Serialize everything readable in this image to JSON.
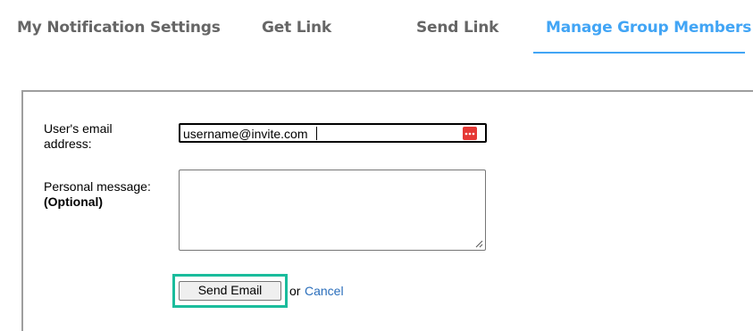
{
  "tabs": {
    "notification_settings": "My Notification Settings",
    "get_link": "Get Link",
    "send_link": "Send Link",
    "manage_group_members": "Manage Group Members",
    "active": "Manage Group Members"
  },
  "form": {
    "email_label_line1": "User's email",
    "email_label_line2": "address:",
    "email_value": "username@invite.com",
    "message_label": "Personal message:",
    "message_optional": "(Optional)",
    "message_value": "",
    "send_button_label": "Send Email",
    "or_text": "or",
    "cancel_label": "Cancel"
  },
  "colors": {
    "active_tab": "#42a5f5",
    "inactive_tab": "#666666",
    "focus_highlight": "#1abc9c",
    "link": "#2a6ebb",
    "password_manager_icon": "#e53935"
  },
  "icons": {
    "email_field_icon": "password-manager-icon",
    "textarea_corner": "resize-grip-icon"
  }
}
